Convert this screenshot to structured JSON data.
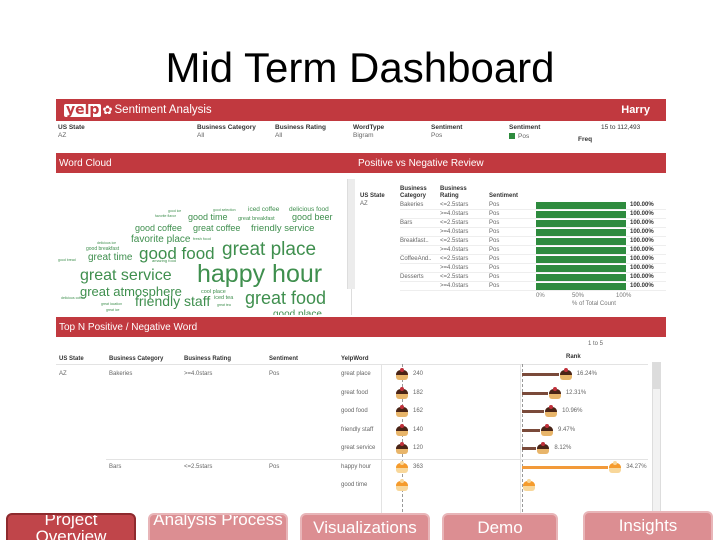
{
  "slide": {
    "title": "Mid Term Dashboard"
  },
  "dashboard": {
    "header": {
      "logo": "yelp",
      "title": "Sentiment Analysis",
      "user": "Harry"
    },
    "filters": [
      {
        "label": "US State",
        "value": "AZ"
      },
      {
        "label": "Business Category",
        "value": "All"
      },
      {
        "label": "Business Rating",
        "value": "All"
      },
      {
        "label": "WordType",
        "value": "Bigram"
      },
      {
        "label": "Sentiment",
        "value": "Pos"
      }
    ],
    "legend": {
      "label": "Sentiment",
      "item": "Pos",
      "color": "#2e8b3e"
    },
    "freq": {
      "range": "15 to 112,493",
      "label": "Freq"
    },
    "sections": {
      "word_cloud": "Word Cloud",
      "pos_vs_neg": "Positive vs Negative Review",
      "top_n": "Top N Positive / Negative Word"
    },
    "word_cloud": {
      "words": [
        "good ice",
        "good selection",
        "iced coffee",
        "delicious food",
        "favorite flavor",
        "good time",
        "great breakfast",
        "good beer",
        "good coffee",
        "great coffee",
        "friendly service",
        "favorite place",
        "fresh food",
        "delicious ice",
        "good breakfast",
        "good food",
        "great place",
        "good bread",
        "great time",
        "amazing food",
        "great service",
        "happy hour",
        "great atmosphere",
        "cool place",
        "delicious coffee",
        "friendly staff",
        "iced tea",
        "great food",
        "great location",
        "great tea",
        "great ice",
        "good place"
      ]
    },
    "pos_vs_neg": {
      "headers": [
        "US State",
        "Business Category",
        "Business Rating",
        "Sentiment"
      ],
      "state": "AZ",
      "rows": [
        {
          "category": "Bakeries",
          "rating": "<=2.5stars",
          "sentiment": "Pos",
          "value": "100.00%",
          "pct": 100
        },
        {
          "category": "",
          "rating": ">=4.0stars",
          "sentiment": "Pos",
          "value": "100.00%",
          "pct": 100
        },
        {
          "category": "Bars",
          "rating": "<=2.5stars",
          "sentiment": "Pos",
          "value": "100.00%",
          "pct": 100
        },
        {
          "category": "",
          "rating": ">=4.0stars",
          "sentiment": "Pos",
          "value": "100.00%",
          "pct": 100
        },
        {
          "category": "Breakfast..",
          "rating": "<=2.5stars",
          "sentiment": "Pos",
          "value": "100.00%",
          "pct": 100
        },
        {
          "category": "",
          "rating": ">=4.0stars",
          "sentiment": "Pos",
          "value": "100.00%",
          "pct": 100
        },
        {
          "category": "CoffeeAnd..",
          "rating": "<=2.5stars",
          "sentiment": "Pos",
          "value": "100.00%",
          "pct": 100
        },
        {
          "category": "",
          "rating": ">=4.0stars",
          "sentiment": "Pos",
          "value": "100.00%",
          "pct": 100
        },
        {
          "category": "Desserts",
          "rating": "<=2.5stars",
          "sentiment": "Pos",
          "value": "100.00%",
          "pct": 100
        },
        {
          "category": "",
          "rating": ">=4.0stars",
          "sentiment": "Pos",
          "value": "100.00%",
          "pct": 100
        }
      ],
      "axis_ticks": [
        "0%",
        "50%",
        "100%"
      ],
      "axis_label": "% of Total Count"
    },
    "top_n": {
      "page": "1 to 5",
      "rank_label": "Rank",
      "headers": [
        "US State",
        "Business Category",
        "Business Rating",
        "Sentiment",
        "YelpWord"
      ],
      "rows": [
        {
          "state": "AZ",
          "category": "Bakeries",
          "rating": ">=4.0stars",
          "sentiment": "Pos",
          "word": "great place",
          "count": "240",
          "pct": "16.24%",
          "share": 16.24,
          "group": 0
        },
        {
          "state": "",
          "category": "",
          "rating": "",
          "sentiment": "",
          "word": "great food",
          "count": "182",
          "pct": "12.31%",
          "share": 12.31,
          "group": 0
        },
        {
          "state": "",
          "category": "",
          "rating": "",
          "sentiment": "",
          "word": "good food",
          "count": "162",
          "pct": "10.96%",
          "share": 10.96,
          "group": 0
        },
        {
          "state": "",
          "category": "",
          "rating": "",
          "sentiment": "",
          "word": "friendly staff",
          "count": "140",
          "pct": "9.47%",
          "share": 9.47,
          "group": 0
        },
        {
          "state": "",
          "category": "",
          "rating": "",
          "sentiment": "",
          "word": "great service",
          "count": "120",
          "pct": "8.12%",
          "share": 8.12,
          "group": 0
        },
        {
          "state": "",
          "category": "Bars",
          "rating": "<=2.5stars",
          "sentiment": "Pos",
          "word": "happy hour",
          "count": "363",
          "pct": "34.27%",
          "share": 34.27,
          "group": 1
        },
        {
          "state": "",
          "category": "",
          "rating": "",
          "sentiment": "",
          "word": "good time",
          "count": "",
          "pct": "",
          "share": 0,
          "group": 1
        }
      ]
    }
  },
  "nav": [
    {
      "label": "Project Overview",
      "active": true
    },
    {
      "label": "Analysis Process",
      "active": false
    },
    {
      "label": "Visualizations",
      "active": false
    },
    {
      "label": "Demo",
      "active": false
    },
    {
      "label": "Insights",
      "active": false
    }
  ]
}
